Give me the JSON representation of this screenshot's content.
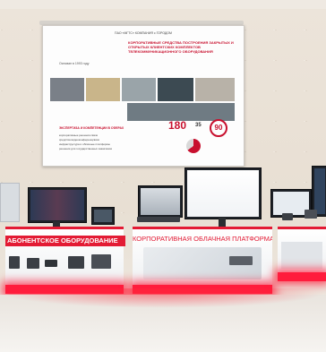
{
  "slide": {
    "header": "ПАО «МГТС» КОМПАНИЯ с ГОРОДОМ",
    "title": "КОРПОРАТИВНЫЕ СРЕДСТВА ПОСТРОЕНИЯ ЗАКРЫТЫХ И ОТКРЫТЫХ КЛИЕНТСКИХ КОМПЛЕКТОВ ТЕЛЕКОММУНИКАЦИОННОГО ОБОРУДОВАНИЯ",
    "subtitle": "Основан в 1993 году",
    "stats": [
      "180",
      "35",
      "90"
    ],
    "bullets_header": "ЭКСПЕРТИЗА И КОМПЕТЕНЦИИ В СФЕРАХ",
    "bullets": [
      "корпоративные решения связи",
      "средства видеоконференцсвязи",
      "инфраструктура и облачные платформы",
      "решения для государственных заказчиков"
    ]
  },
  "counters": {
    "left_banner": "АБОНЕНТСКОЕ ОБОРУДОВАНИЕ",
    "center_banner": "КОРПОРАТИВНАЯ ОБЛАЧНАЯ ПЛАТФОРМА"
  },
  "colors": {
    "brand_red": "#e31b34",
    "wall": "#e8dfd3"
  }
}
